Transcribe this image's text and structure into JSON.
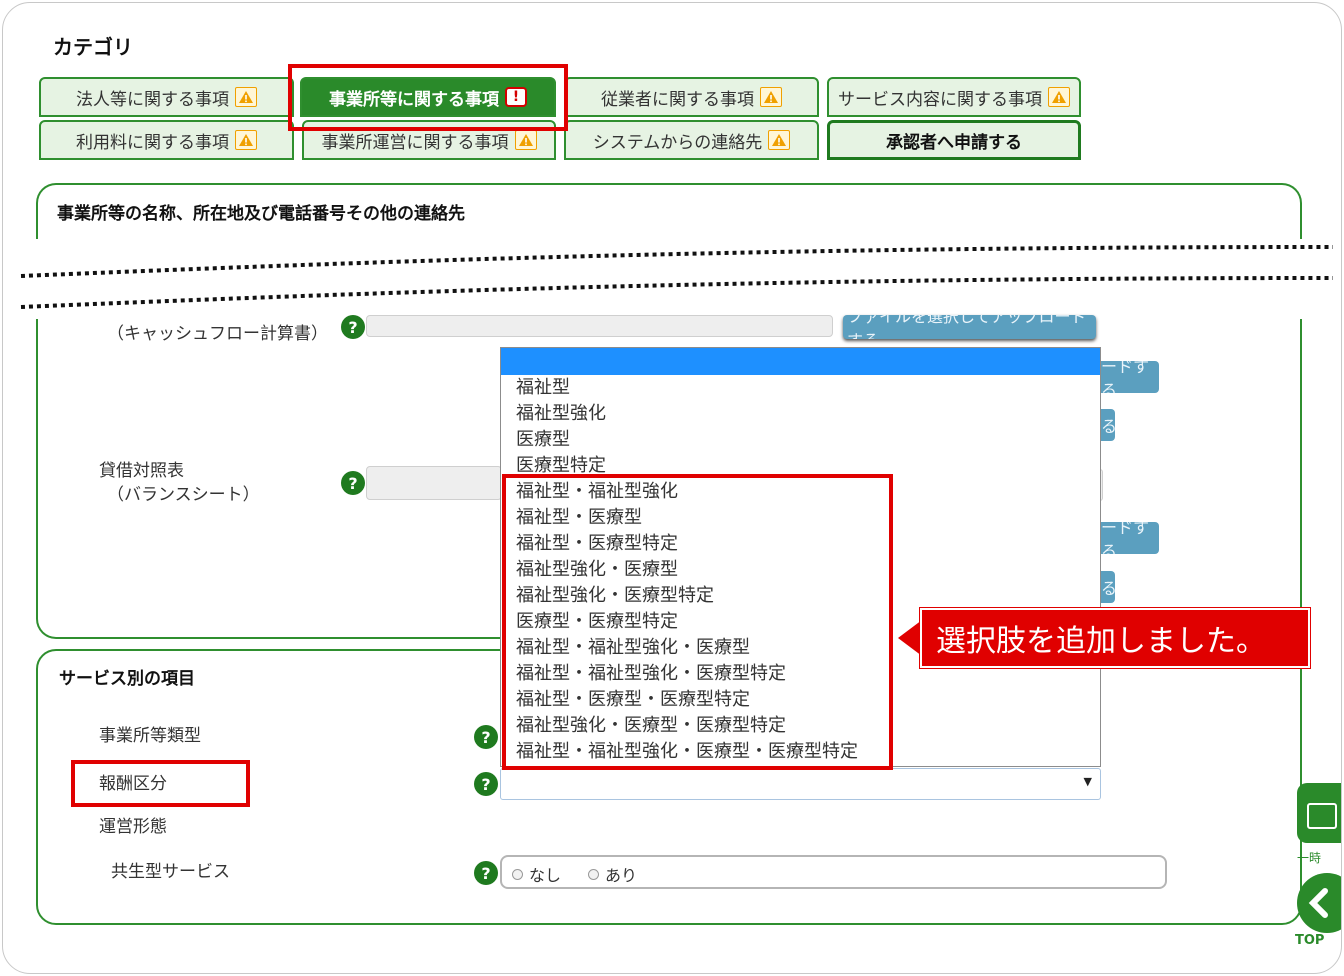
{
  "category": {
    "title": "カテゴリ"
  },
  "tabs": {
    "row1": [
      {
        "label": "法人等に関する事項",
        "icon": "warning-icon"
      },
      {
        "label": "事業所等に関する事項",
        "icon": "error-icon"
      },
      {
        "label": "従業者に関する事項",
        "icon": "warning-icon"
      },
      {
        "label": "サービス内容に関する事項",
        "icon": "warning-icon"
      }
    ],
    "row2": [
      {
        "label": "利用料に関する事項",
        "icon": "warning-icon"
      },
      {
        "label": "事業所運営に関する事項",
        "icon": "warning-icon"
      },
      {
        "label": "システムからの連絡先",
        "icon": "warning-icon"
      }
    ],
    "apply_label": "承認者へ申請する"
  },
  "section_top": {
    "title": "事業所等の名称、所在地及び電話番号その他の連絡先"
  },
  "finance": {
    "cashflow_label": "（キャッシュフロー計算書）",
    "upload_label": "ファイルを選択してアップロードする",
    "upload_label_short": "ードする",
    "balance_label_1": "貸借対照表",
    "balance_label_2": "（バランスシート）",
    "delete_label_short": "る"
  },
  "dropdown": {
    "options": [
      "",
      "福祉型",
      "福祉型強化",
      "医療型",
      "医療型特定",
      "福祉型・福祉型強化",
      "福祉型・医療型",
      "福祉型・医療型特定",
      "福祉型強化・医療型",
      "福祉型強化・医療型特定",
      "医療型・医療型特定",
      "福祉型・福祉型強化・医療型",
      "福祉型・福祉型強化・医療型特定",
      "福祉型・医療型・医療型特定",
      "福祉型強化・医療型・医療型特定",
      "福祉型・福祉型強化・医療型・医療型特定"
    ]
  },
  "callout": {
    "text": "選択肢を追加しました。"
  },
  "service": {
    "title": "サービス別の項目",
    "type_label": "事業所等類型",
    "fee_label": "報酬区分",
    "mgmt_label": "運営形態",
    "shared_label": "共生型サービス",
    "radio_none": "なし",
    "radio_yes": "あり"
  },
  "side": {
    "top_label": "TOP",
    "ichi_label": "一時"
  },
  "colors": {
    "green": "#2a8a2a",
    "highlight_red": "#e00000",
    "selected_blue": "#1e90ff"
  }
}
